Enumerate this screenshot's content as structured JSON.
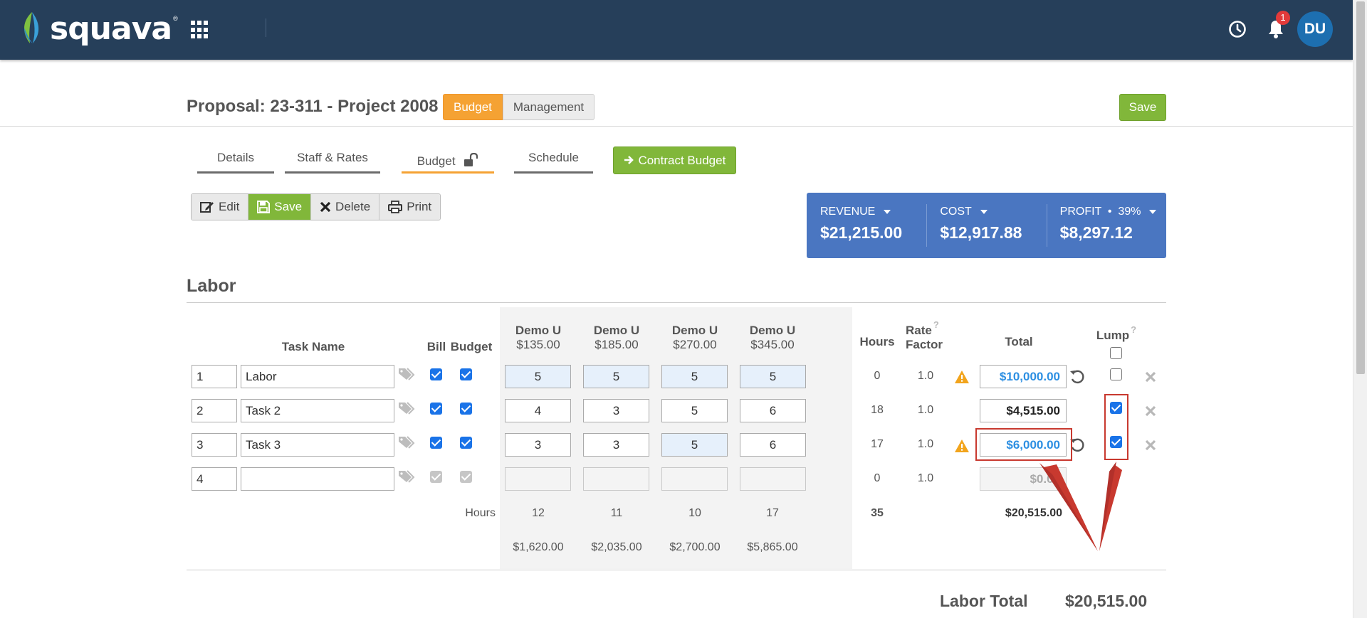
{
  "app": {
    "logo_text": "squava",
    "notification_count": "1",
    "avatar_initials": "DU",
    "colors": {
      "navbar": "#263f5a",
      "accent_orange": "#f5a233",
      "accent_green": "#81b73a",
      "summary_blue": "#4a76c1",
      "link_blue": "#2d8fe2"
    }
  },
  "header": {
    "title": "Proposal: 23-311 - Project 2008",
    "toggle": {
      "budget": "Budget",
      "management": "Management"
    },
    "save_label": "Save"
  },
  "tabs": [
    {
      "label": "Details"
    },
    {
      "label": "Staff & Rates"
    },
    {
      "label": "Budget"
    },
    {
      "label": "Schedule"
    }
  ],
  "contract_budget_label": "Contract Budget",
  "actions": {
    "edit": "Edit",
    "save": "Save",
    "delete": "Delete",
    "print": "Print"
  },
  "summary": {
    "revenue_label": "REVENUE",
    "revenue_value": "$21,215.00",
    "cost_label": "COST",
    "cost_value": "$12,917.88",
    "profit_label": "PROFIT  •  39%",
    "profit_value": "$8,297.12"
  },
  "labor": {
    "title": "Labor",
    "headers": {
      "task_name": "Task Name",
      "bill": "Bill",
      "budget": "Budget",
      "hours": "Hours",
      "rate_factor_1": "Rate",
      "rate_factor_2": "Factor",
      "total": "Total",
      "lump": "Lump",
      "help": "?"
    },
    "staff": [
      {
        "name": "Demo U",
        "rate": "$135.00"
      },
      {
        "name": "Demo U",
        "rate": "$185.00"
      },
      {
        "name": "Demo U",
        "rate": "$270.00"
      },
      {
        "name": "Demo U",
        "rate": "$345.00"
      }
    ],
    "rows": [
      {
        "num": "1",
        "name": "Labor",
        "hours": [
          "5",
          "5",
          "5",
          "5"
        ],
        "total_hours": "0",
        "rate_factor": "1.0",
        "total": "$10,000.00"
      },
      {
        "num": "2",
        "name": "Task 2",
        "hours": [
          "4",
          "3",
          "5",
          "6"
        ],
        "total_hours": "18",
        "rate_factor": "1.0",
        "total": "$4,515.00"
      },
      {
        "num": "3",
        "name": "Task 3",
        "hours": [
          "3",
          "3",
          "5",
          "6"
        ],
        "total_hours": "17",
        "rate_factor": "1.0",
        "total": "$6,000.00"
      },
      {
        "num": "4",
        "name": "",
        "hours": [
          "",
          "",
          "",
          ""
        ],
        "total_hours": "0",
        "rate_factor": "1.0",
        "total": "$0.00"
      }
    ],
    "footer": {
      "hours_label": "Hours",
      "staff_hours": [
        "12",
        "11",
        "10",
        "17"
      ],
      "grand_hours": "35",
      "grand_total": "$20,515.00",
      "staff_costs": [
        "$1,620.00",
        "$2,035.00",
        "$2,700.00",
        "$5,865.00"
      ]
    },
    "labor_total_label": "Labor Total",
    "labor_total_value": "$20,515.00"
  }
}
